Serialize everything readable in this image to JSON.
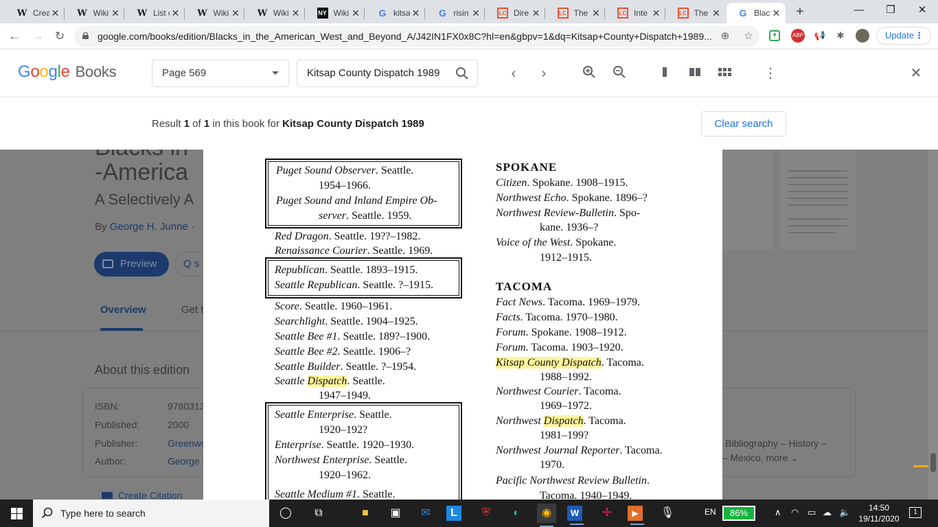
{
  "browser": {
    "tabs": [
      {
        "icon": "wikipedia-icon",
        "glyph": "W",
        "title": "Crea"
      },
      {
        "icon": "wikipedia-icon",
        "glyph": "W",
        "title": "Wiki"
      },
      {
        "icon": "wikipedia-icon",
        "glyph": "W",
        "title": "List o"
      },
      {
        "icon": "wikipedia-icon",
        "glyph": "W",
        "title": "Wiki"
      },
      {
        "icon": "wikipedia-icon",
        "glyph": "W",
        "title": "Wiki"
      },
      {
        "icon": "nyt-icon",
        "glyph": "NY",
        "title": "Wiki"
      },
      {
        "icon": "google-icon",
        "glyph": "G",
        "title": "kitsa"
      },
      {
        "icon": "google-icon",
        "glyph": "G",
        "title": "risin"
      },
      {
        "icon": "loc-icon",
        "glyph": "LC",
        "title": "Dire"
      },
      {
        "icon": "loc-icon",
        "glyph": "LC",
        "title": "The"
      },
      {
        "icon": "loc-icon",
        "glyph": "LC",
        "title": "Inte"
      },
      {
        "icon": "loc-icon",
        "glyph": "LC",
        "title": "The"
      },
      {
        "icon": "google-icon",
        "glyph": "G",
        "title": "Blac"
      }
    ],
    "active_tab": 12,
    "url": "google.com/books/edition/Blacks_in_the_American_West_and_Beyond_A/J42IN1FX0x8C?hl=en&gbpv=1&dq=Kitsap+County+Dispatch+1989...",
    "update_label": "Update"
  },
  "books_header": {
    "logo_google": [
      "G",
      "o",
      "o",
      "g",
      "l",
      "e"
    ],
    "logo_books": "Books",
    "page_selector": "Page 569",
    "search_value": "Kitsap County Dispatch 1989"
  },
  "result": {
    "prefix": "Result ",
    "index": "1",
    "of": " of ",
    "total": "1",
    "mid": " in this book for ",
    "query": "Kitsap County Dispatch 1989",
    "clear_label": "Clear search"
  },
  "background_page": {
    "title_line1": "Blacks in",
    "title_line2": "-America",
    "subtitle": "A Selectively A",
    "by_prefix": "By ",
    "author_link": "George H. Junne",
    "by_suffix": " · ",
    "preview_label": "Preview",
    "search_glyph": "Q s",
    "tab_overview": "Overview",
    "tab_get": "Get t",
    "about_heading": "About this edition",
    "isbn_label": "ISBN:",
    "isbn_value": "9780313",
    "published_label": "Published:",
    "published_value": "2000",
    "publisher_label": "Publisher:",
    "publisher_value": "Greenwo",
    "author_label": "Author:",
    "author_value": "George H",
    "subjects_line1": "Bibliography – History –",
    "subjects_line2": "n – Mexico, more",
    "create_citation": "Create Citation"
  },
  "book_page": {
    "left_entries": [
      {
        "title": "Puget Sound Observer",
        "rest": ". Seattle."
      },
      {
        "title": "",
        "rest": "1954–1966."
      },
      {
        "title": "Puget Sound and Inland Empire Ob-",
        "rest": ""
      },
      {
        "title": "server",
        "rest": ". Seattle. 1959."
      },
      {
        "title": "Red Dragon",
        "rest": ". Seattle. 19??–1982."
      },
      {
        "title": "Renaissance Courier",
        "rest": ". Seattle. 1969."
      },
      {
        "title": "Republican",
        "rest": ". Seattle. 1893–1915."
      },
      {
        "title": "Seattle Republican",
        "rest": ". Seattle. ?–1915."
      },
      {
        "title": "Score",
        "rest": ". Seattle. 1960–1961."
      },
      {
        "title": "Searchlight",
        "rest": ". Seattle. 1904–1925."
      },
      {
        "title": "Seattle Bee #1",
        "rest": ". Seattle. 189?–1900."
      },
      {
        "title": "Seattle Bee #2",
        "rest": ". Seattle. 1906–?"
      },
      {
        "title": "Seattle Builder",
        "rest": ". Seattle. ?–1954."
      },
      {
        "title_a": "Seattle ",
        "title_hl": "Dispatch",
        "rest": ". Seattle."
      },
      {
        "title": "",
        "rest": "1947–1949."
      },
      {
        "title": "Seattle Enterprise",
        "rest": ". Seattle."
      },
      {
        "title": "",
        "rest": "1920–192?"
      },
      {
        "title": "Enterprise",
        "rest": ". Seattle. 1920–1930."
      },
      {
        "title": "Northwest Enterprise",
        "rest": ". Seattle."
      },
      {
        "title": "",
        "rest": "1920–1962."
      },
      {
        "title": "Seattle Medium #1",
        "rest": ". Seattle."
      }
    ],
    "spokane_heading": "SPOKANE",
    "spokane_entries": [
      {
        "title": "Citizen",
        "rest": ". Spokane. 1908–1915."
      },
      {
        "title": "Northwest Echo",
        "rest": ". Spokane. 1896–?"
      },
      {
        "title": "Northwest Review-Bulletin",
        "rest": ". Spo-"
      },
      {
        "title": "",
        "rest": "kane. 1936–?"
      },
      {
        "title": "Voice of the West",
        "rest": ". Spokane."
      },
      {
        "title": "",
        "rest": "1912–1915."
      }
    ],
    "tacoma_heading": "TACOMA",
    "tacoma_entries": [
      {
        "title": "Fact News",
        "rest": ". Tacoma. 1969–1979."
      },
      {
        "title": "Facts",
        "rest": ". Tacoma. 1970–1980."
      },
      {
        "title": "Forum",
        "rest": ". Spokane. 1908–1912."
      },
      {
        "title": "Forum",
        "rest": ". Tacoma. 1903–1920."
      },
      {
        "title_hl": "Kitsap County Dispatch",
        "rest": ". Tacoma."
      },
      {
        "title": "",
        "rest": "1988–1992."
      },
      {
        "title": "Northwest Courier",
        "rest": ". Tacoma."
      },
      {
        "title": "",
        "rest": "1969–1972."
      },
      {
        "title_a": "Northwest ",
        "title_hl": "Dispatch",
        "rest": ". Tacoma."
      },
      {
        "title": "",
        "rest": "1981–199?"
      },
      {
        "title": "Northwest Journal Reporter",
        "rest": ". Tacoma."
      },
      {
        "title": "",
        "rest": "1970."
      },
      {
        "title": "Pacific Northwest Review Bulletin",
        "rest": "."
      },
      {
        "title": "",
        "rest": "Tacoma. 1940–1949."
      }
    ]
  },
  "taskbar": {
    "search_placeholder": "Type here to search",
    "language": "EN",
    "battery": "86%",
    "time": "14:50",
    "date": "19/11/2020",
    "notification_count": "1"
  },
  "colors": {
    "highlight": "#fff59d",
    "accent": "#1a73e8",
    "overlay": "#7f7f7f"
  }
}
